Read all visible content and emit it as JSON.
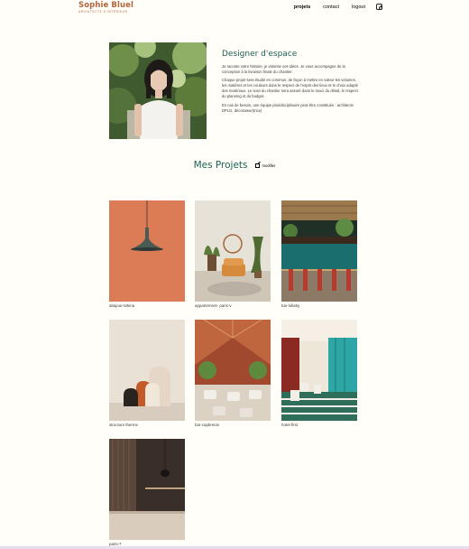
{
  "header": {
    "logo_name": "Sophie Bluel",
    "logo_subtitle": "architecte d'intérieur",
    "nav": [
      "projets",
      "contact",
      "logout"
    ],
    "accent_color": "#B1663C",
    "icons": [
      "instagram-icon"
    ]
  },
  "introduction": {
    "title": "Designer d'espace",
    "paragraphs": [
      "Je raconte votre histoire, je valorise vos idées. Je vous accompagne de la conception à la livraison finale du chantier.",
      "Chaque projet sera étudié en commun, de façon à mettre en valeur les volumes, les matières et les couleurs dans le respect de l'esprit des lieux et le choix adapté des matériaux. Le suivi du chantier sera assuré dans le souci du détail, le respect du planning et du budget.",
      "En cas de besoin, une équipe pluridisciplinaire peut-être constituée : architecte DPLG, décorateur(trice)"
    ],
    "title_color": "#1D6154"
  },
  "portfolio": {
    "title": "Mes Projets",
    "edit_label": "modifier",
    "projects": [
      "abajour-tahina",
      "appartement- paris-v",
      "bar-lullaby",
      "structure therme",
      "bar-capbreton",
      "hotel-first",
      "paris-7"
    ]
  }
}
